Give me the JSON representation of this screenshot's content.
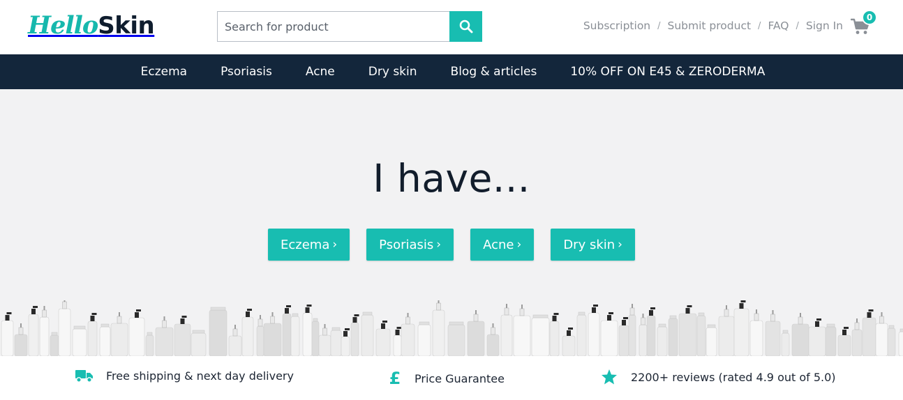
{
  "brand": {
    "part1": "Hello",
    "part2": "Skin"
  },
  "search": {
    "placeholder": "Search for product",
    "value": ""
  },
  "top_links": [
    {
      "label": "Subscription"
    },
    {
      "label": "Submit product"
    },
    {
      "label": "FAQ"
    },
    {
      "label": "Sign In"
    }
  ],
  "link_separator": "/",
  "cart": {
    "count": "0",
    "icon": "shopping-cart-icon"
  },
  "nav": [
    {
      "label": "Eczema"
    },
    {
      "label": "Psoriasis"
    },
    {
      "label": "Acne"
    },
    {
      "label": "Dry skin"
    },
    {
      "label": "Blog & articles"
    },
    {
      "label": "10% OFF ON E45 & ZERODERMA"
    }
  ],
  "hero": {
    "title": "I have...",
    "buttons": [
      {
        "label": "Eczema"
      },
      {
        "label": "Psoriasis"
      },
      {
        "label": "Acne"
      },
      {
        "label": "Dry skin"
      }
    ],
    "chevron": "›"
  },
  "features": [
    {
      "icon": "truck-icon",
      "text": "Free shipping & next day delivery"
    },
    {
      "icon": "pound-icon",
      "text": "Price Guarantee"
    },
    {
      "icon": "star-icon",
      "text": "2200+ reviews (rated 4.9 out of 5.0)"
    }
  ],
  "colors": {
    "accent": "#18bdb1",
    "nav_bg": "#13263b",
    "hero_bg": "#f2f2f3",
    "text_dark": "#121d2c",
    "link_gray": "#8a8f96"
  }
}
